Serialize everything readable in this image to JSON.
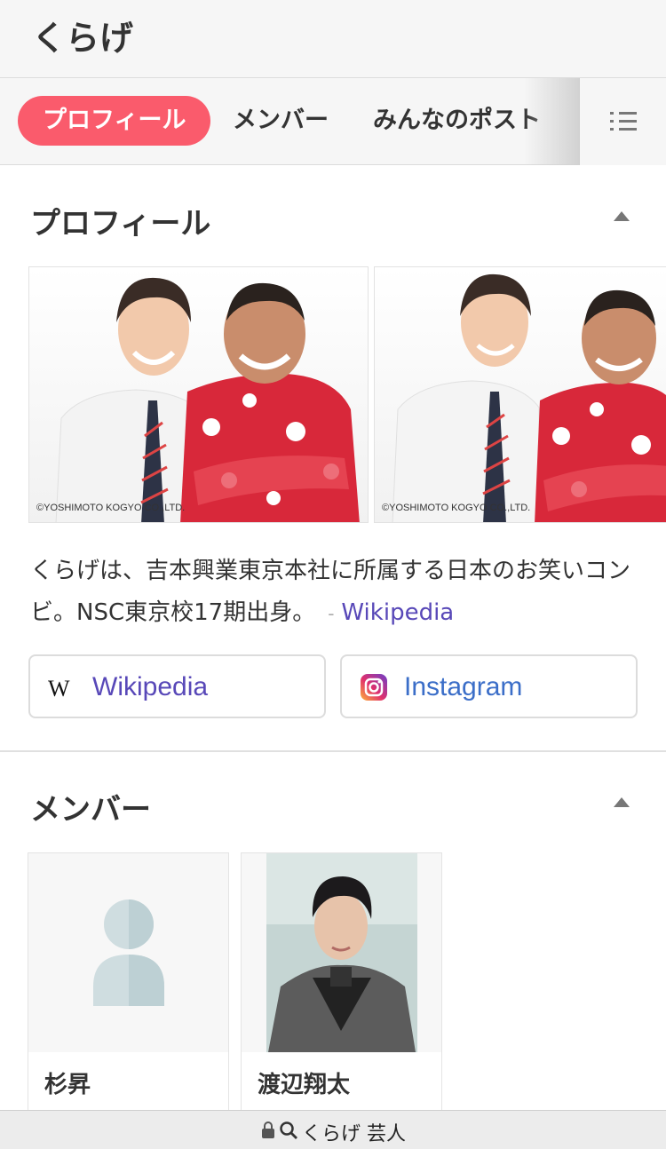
{
  "header": {
    "title": "くらげ"
  },
  "tabs": [
    {
      "label": "プロフィール",
      "active": true
    },
    {
      "label": "メンバー",
      "active": false
    },
    {
      "label": "みんなのポスト",
      "active": false
    }
  ],
  "profile": {
    "title": "プロフィール",
    "photo_credits": [
      "©YOSHIMOTO KOGYO CO.,LTD.",
      "©YOSHIMOTO KOGYO CO.,LTD."
    ],
    "description": "くらげは、吉本興業東京本社に所属する日本のお笑いコンビ。NSC東京校17期出身。",
    "source_dash": "-",
    "source_label": "Wikipedia",
    "links": [
      {
        "label": "Wikipedia",
        "icon": "wikipedia-icon",
        "color": "#5848b8"
      },
      {
        "label": "Instagram",
        "icon": "instagram-icon",
        "color": "#3b6ec8"
      }
    ]
  },
  "members": {
    "title": "メンバー",
    "items": [
      {
        "name": "杉昇"
      },
      {
        "name": "渡辺翔太"
      }
    ]
  },
  "bottom_bar": {
    "query": "くらげ 芸人"
  },
  "colors": {
    "accent": "#fa5b6c",
    "link": "#5848b8",
    "instagram_text": "#3b6ec8"
  }
}
